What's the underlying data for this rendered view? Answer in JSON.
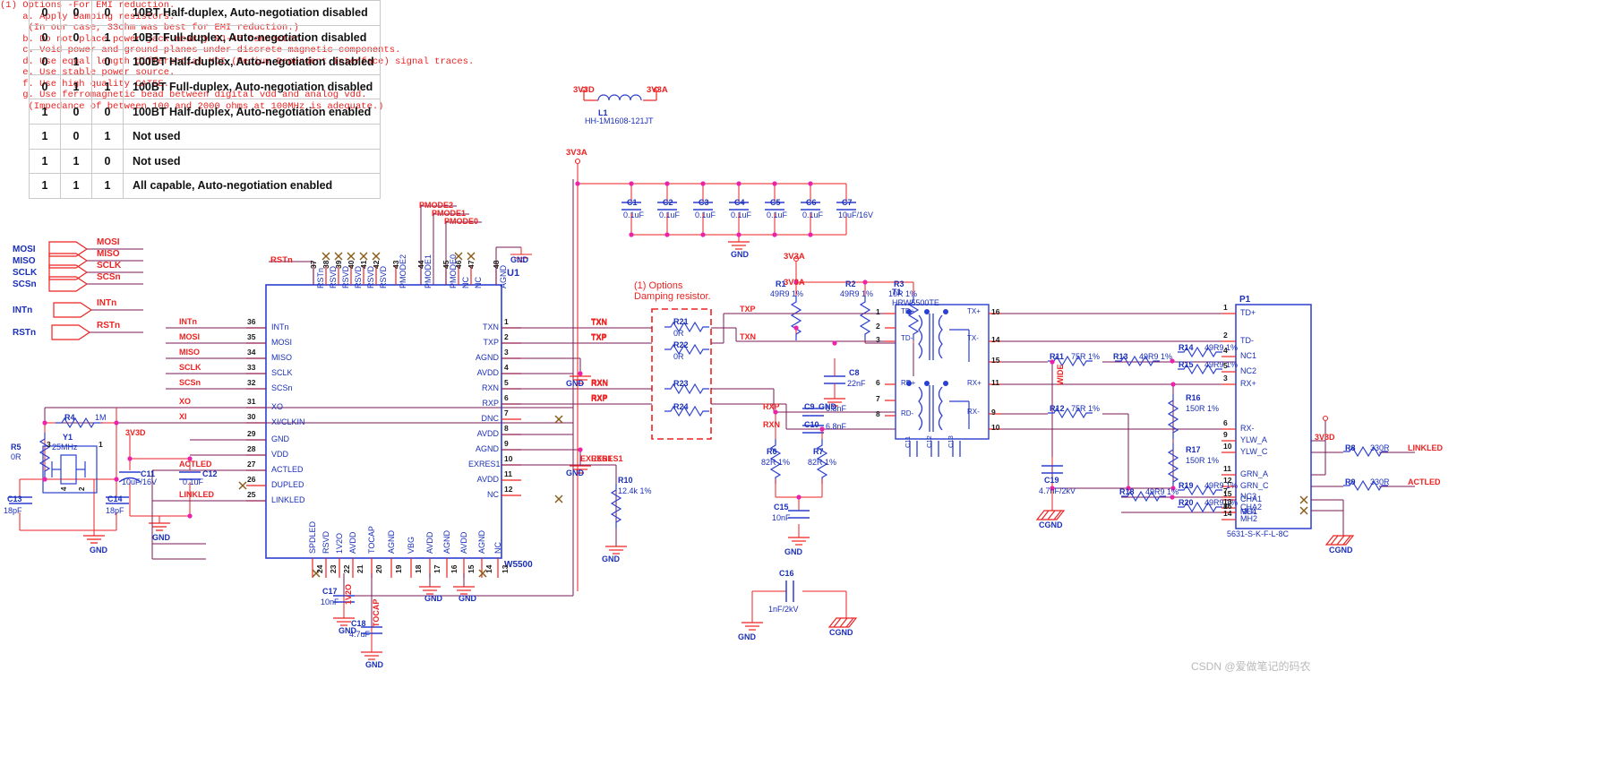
{
  "truth_table": {
    "rows": [
      {
        "b0": "0",
        "b1": "0",
        "b2": "0",
        "desc": "10BT Half-duplex, Auto-negotiation disabled"
      },
      {
        "b0": "0",
        "b1": "0",
        "b2": "1",
        "desc": "10BT Full-duplex, Auto-negotiation disabled"
      },
      {
        "b0": "0",
        "b1": "1",
        "b2": "0",
        "desc": "100BT Half-duplex, Auto-negotiation disabled"
      },
      {
        "b0": "0",
        "b1": "1",
        "b2": "1",
        "desc": "100BT Full-duplex, Auto-negotiation disabled"
      },
      {
        "b0": "1",
        "b1": "0",
        "b2": "0",
        "desc": "100BT Half-duplex, Auto-negotiation enabled"
      },
      {
        "b0": "1",
        "b1": "0",
        "b2": "1",
        "desc": "Not used"
      },
      {
        "b0": "1",
        "b1": "1",
        "b2": "0",
        "desc": "Not used"
      },
      {
        "b0": "1",
        "b1": "1",
        "b2": "1",
        "desc": "All capable, Auto-negotiation enabled"
      }
    ]
  },
  "ports": {
    "left": [
      {
        "label": "MOSI",
        "net": "MOSI",
        "dir": "out"
      },
      {
        "label": "MISO",
        "net": "MISO",
        "dir": "in"
      },
      {
        "label": "SCLK",
        "net": "SCLK",
        "dir": "out"
      },
      {
        "label": "SCSn",
        "net": "SCSn",
        "dir": "out"
      },
      {
        "label": "INTn",
        "net": "INTn",
        "dir": "in"
      },
      {
        "label": "RSTn",
        "net": "RSTn",
        "dir": "out"
      }
    ]
  },
  "u1": {
    "refdes": "U1",
    "value": "W5500",
    "top_pins": [
      {
        "num": "37",
        "name": "RSTn"
      },
      {
        "num": "38",
        "name": "RSVD"
      },
      {
        "num": "39",
        "name": "RSVD"
      },
      {
        "num": "40",
        "name": "RSVD"
      },
      {
        "num": "41",
        "name": "RSVD"
      },
      {
        "num": "42",
        "name": "RSVD"
      },
      {
        "num": "43",
        "name": "PMODE2"
      },
      {
        "num": "44",
        "name": "PMODE1"
      },
      {
        "num": "45",
        "name": "PMODE0"
      },
      {
        "num": "46",
        "name": "NC"
      },
      {
        "num": "47",
        "name": "NC"
      },
      {
        "num": "48",
        "name": "AGND"
      }
    ],
    "left_pins": [
      {
        "num": "36",
        "name": "INTn",
        "net": "INTn"
      },
      {
        "num": "35",
        "name": "MOSI",
        "net": "MOSI"
      },
      {
        "num": "34",
        "name": "MISO",
        "net": "MISO"
      },
      {
        "num": "33",
        "name": "SCLK",
        "net": "SCLK"
      },
      {
        "num": "32",
        "name": "SCSn",
        "net": "SCSn"
      },
      {
        "num": "31",
        "name": "XO",
        "net": "XO"
      },
      {
        "num": "30",
        "name": "XI/CLKIN",
        "net": "XI"
      },
      {
        "num": "29",
        "name": "GND",
        "net": ""
      },
      {
        "num": "28",
        "name": "VDD",
        "net": ""
      },
      {
        "num": "27",
        "name": "ACTLED",
        "net": "ACTLED"
      },
      {
        "num": "26",
        "name": "DUPLED",
        "net": ""
      },
      {
        "num": "25",
        "name": "LINKLED",
        "net": "LINKLED"
      }
    ],
    "right_pins": [
      {
        "num": "1",
        "name": "TXN",
        "net": "TXN"
      },
      {
        "num": "2",
        "name": "TXP",
        "net": "TXP"
      },
      {
        "num": "3",
        "name": "AGND",
        "net": ""
      },
      {
        "num": "4",
        "name": "AVDD",
        "net": ""
      },
      {
        "num": "5",
        "name": "RXN",
        "net": "RXN"
      },
      {
        "num": "6",
        "name": "RXP",
        "net": "RXP"
      },
      {
        "num": "7",
        "name": "DNC",
        "net": ""
      },
      {
        "num": "8",
        "name": "AVDD",
        "net": ""
      },
      {
        "num": "9",
        "name": "AGND",
        "net": ""
      },
      {
        "num": "10",
        "name": "EXRES1",
        "net": "EXRES1"
      },
      {
        "num": "11",
        "name": "AVDD",
        "net": ""
      },
      {
        "num": "12",
        "name": "NC",
        "net": ""
      }
    ],
    "bottom_pins": [
      {
        "num": "24",
        "name": "SPDLED"
      },
      {
        "num": "23",
        "name": "RSVD"
      },
      {
        "num": "22",
        "name": "1V2O"
      },
      {
        "num": "21",
        "name": "AVDD"
      },
      {
        "num": "20",
        "name": "TOCAP"
      },
      {
        "num": "19",
        "name": "AGND"
      },
      {
        "num": "18",
        "name": "VBG"
      },
      {
        "num": "17",
        "name": "AVDD"
      },
      {
        "num": "16",
        "name": "AGND"
      },
      {
        "num": "15",
        "name": "AVDD"
      },
      {
        "num": "14",
        "name": "AGND"
      },
      {
        "num": "13",
        "name": "NC"
      }
    ]
  },
  "nets": {
    "v3v3d": "3V3D",
    "v3v3a": "3V3A",
    "gnd": "GND",
    "cgnd": "CGND",
    "txp": "TXP",
    "txn": "TXN",
    "rxp": "RXP",
    "rxn": "RXN",
    "exres1": "EXRES1",
    "xo": "XO",
    "xi": "XI",
    "actled": "ACTLED",
    "linkled": "LINKLED",
    "pmode0": "PMODE0",
    "pmode1": "PMODE1",
    "pmode2": "PMODE2",
    "rstn": "RSTn",
    "intn": "INTn",
    "mosi": "MOSI",
    "miso": "MISO",
    "sclk": "SCLK",
    "scsn": "SCSn",
    "wide": "WIDE",
    "v1v2o": "1V2O",
    "tocap": "TOCAP"
  },
  "components": {
    "L1": {
      "ref": "L1",
      "val": "HH-1M1608-121JT"
    },
    "Y1": {
      "ref": "Y1",
      "val": "25MHz"
    },
    "R4": {
      "ref": "R4",
      "val": "1M"
    },
    "R5": {
      "ref": "R5",
      "val": "0R"
    },
    "C11": {
      "ref": "C11",
      "val": "10uF/16V"
    },
    "C12": {
      "ref": "C12",
      "val": "0.1uF"
    },
    "C13": {
      "ref": "C13",
      "val": "18pF"
    },
    "C14": {
      "ref": "C14",
      "val": "18pF"
    },
    "C17": {
      "ref": "C17",
      "val": "10nF"
    },
    "C18": {
      "ref": "C18",
      "val": "4.7uF"
    },
    "C1": {
      "ref": "C1",
      "val": "0.1uF"
    },
    "C2": {
      "ref": "C2",
      "val": "0.1uF"
    },
    "C3": {
      "ref": "C3",
      "val": "0.1uF"
    },
    "C4": {
      "ref": "C4",
      "val": "0.1uF"
    },
    "C5": {
      "ref": "C5",
      "val": "0.1uF"
    },
    "C6": {
      "ref": "C6",
      "val": "0.1uF"
    },
    "C7": {
      "ref": "C7",
      "val": "10uF/16V"
    },
    "C8": {
      "ref": "C8",
      "val": "22nF"
    },
    "C9": {
      "ref": "C9",
      "val": "6.8nF"
    },
    "C10": {
      "ref": "C10",
      "val": "6.8nF"
    },
    "C15": {
      "ref": "C15",
      "val": "10nF"
    },
    "C16": {
      "ref": "C16",
      "val": "1nF/2kV"
    },
    "C19": {
      "ref": "C19",
      "val": "4.7nF/2kV"
    },
    "R1": {
      "ref": "R1",
      "val": "49R9 1%"
    },
    "R2": {
      "ref": "R2",
      "val": "49R9 1%"
    },
    "R3": {
      "ref": "R3",
      "val": "10R 1%"
    },
    "R6": {
      "ref": "R6",
      "val": "82R 1%"
    },
    "R7": {
      "ref": "R7",
      "val": "82R 1%"
    },
    "R10": {
      "ref": "R10",
      "val": "12.4k 1%"
    },
    "R11": {
      "ref": "R11",
      "val": "75R 1%"
    },
    "R12": {
      "ref": "R12",
      "val": "75R 1%"
    },
    "R13": {
      "ref": "R13",
      "val": "49R9 1%"
    },
    "R14": {
      "ref": "R14",
      "val": "49R9 1%"
    },
    "R15": {
      "ref": "R15",
      "val": "49R9 1%"
    },
    "R16": {
      "ref": "R16",
      "val": "150R 1%"
    },
    "R17": {
      "ref": "R17",
      "val": "150R 1%"
    },
    "R18": {
      "ref": "R18",
      "val": "49R9 1%"
    },
    "R19": {
      "ref": "R19",
      "val": "49R9 1%"
    },
    "R20": {
      "ref": "R20",
      "val": "49R9 1%"
    },
    "R21": {
      "ref": "R21",
      "val": "0R"
    },
    "R22": {
      "ref": "R22",
      "val": "0R"
    },
    "R23": {
      "ref": "R23",
      "val": ""
    },
    "R24": {
      "ref": "R24",
      "val": ""
    },
    "R8": {
      "ref": "R8",
      "val": "330R"
    },
    "R9": {
      "ref": "R9",
      "val": "330R"
    },
    "T1": {
      "ref": "T1",
      "val": "HRW5500TE"
    },
    "P1": {
      "ref": "P1",
      "val": "5631-S-K-F-L-8C"
    }
  },
  "transformer": {
    "left_pins": [
      "1",
      "2",
      "3",
      "6",
      "7",
      "8"
    ],
    "right_pins": [
      "16",
      "14",
      "15",
      "11",
      "9",
      "10"
    ],
    "labels": [
      "TD+",
      "CT1",
      "TD-",
      "RD+",
      "CT2",
      "RD-",
      "TX+",
      "TX-",
      "RX+",
      "RX-"
    ],
    "caps": [
      "C11",
      "C12",
      "C13",
      "C14"
    ]
  },
  "rj45": {
    "ref": "P1",
    "value": "5631-S-K-F-L-8C",
    "pins": [
      {
        "num": "1",
        "name": "TD+"
      },
      {
        "num": "2",
        "name": "TD-"
      },
      {
        "num": "4",
        "name": "NC1"
      },
      {
        "num": "5",
        "name": "NC2"
      },
      {
        "num": "3",
        "name": "RX+"
      },
      {
        "num": "6",
        "name": "RX-"
      },
      {
        "num": "7",
        "name": "NC3"
      },
      {
        "num": "8",
        "name": "NC4"
      },
      {
        "num": "9",
        "name": "YLW_A"
      },
      {
        "num": "10",
        "name": "YLW_C"
      },
      {
        "num": "11",
        "name": "GRN_A"
      },
      {
        "num": "12",
        "name": "GRN_C"
      },
      {
        "num": "15",
        "name": "CHA1"
      },
      {
        "num": "13",
        "name": "CHA2"
      },
      {
        "num": "16",
        "name": "MH1"
      },
      {
        "num": "14",
        "name": "MH2"
      }
    ]
  },
  "annotations": {
    "option_title": "(1) Options",
    "option_sub": "Damping resistor.",
    "notes": "(1) Options -For EMI reduction.\n    a. Apply Damping resistors.\n     (In our case, 33ohm was best for EMI reduction.)\n    b. Do not place power jack nearby RJ-45 connector.\n    c. Void power and ground planes under discrete magnetic components.\n    d. Use equal length differential MDI (Medium Dependent Interface) signal traces.\n    e. Use stable power source.\n    f. Use high quality CAT5E.\n    g. Use ferromagnetic bead between digital vdd and analog vdd.\n     (Impedance of between 100 and 2000 ohms at 100MHz is adequate.)"
  },
  "watermark": "CSDN @爱做笔记的码农"
}
